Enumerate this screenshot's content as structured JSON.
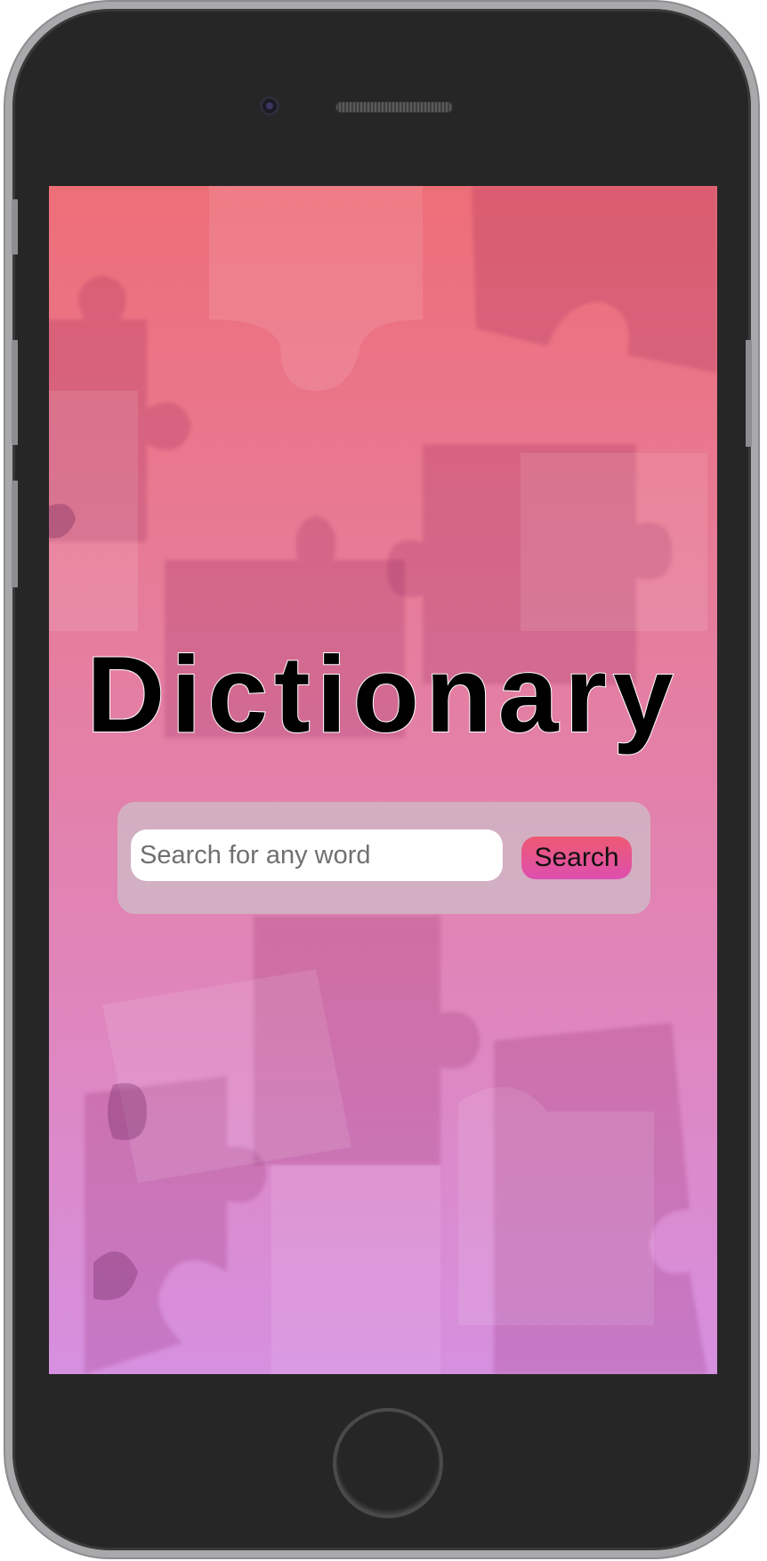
{
  "app": {
    "title": "Dictionary"
  },
  "search": {
    "placeholder": "Search for any word",
    "value": "",
    "button_label": "Search"
  },
  "theme": {
    "background_gradient": [
      "#ee6e78",
      "#d690e0"
    ],
    "panel_color": "#cdbec8",
    "button_gradient": [
      "#ee5a72",
      "#dd4fb0"
    ],
    "device_body": "#262626",
    "device_frame": "#a9a9ab"
  },
  "icons": {
    "background": "puzzle-pieces-pattern",
    "camera": "front-camera-icon",
    "speaker": "earpiece-speaker",
    "home": "home-button"
  }
}
